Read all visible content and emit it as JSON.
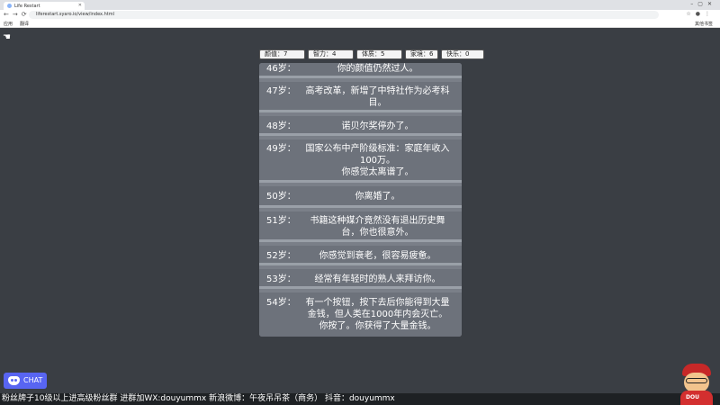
{
  "browser": {
    "tab_title": "Life Restart",
    "url": "liferestart.syaro.io/view/index.html",
    "bookmarks": {
      "apps": "应用",
      "folder": "翻译",
      "other": "其他书签"
    }
  },
  "stats": [
    {
      "label": "颜值：7"
    },
    {
      "label": "智力：4"
    },
    {
      "label": "体质：5"
    },
    {
      "label": "家境：6"
    },
    {
      "label": "快乐：0"
    }
  ],
  "events": [
    {
      "age": "46岁：",
      "lines": [
        "你的颜值仍然过人。"
      ]
    },
    {
      "age": "47岁：",
      "lines": [
        "高考改革，新增了中特社作为必考科",
        "目。"
      ]
    },
    {
      "age": "48岁：",
      "lines": [
        "诺贝尔奖停办了。"
      ]
    },
    {
      "age": "49岁：",
      "lines": [
        "国家公布中产阶级标准：家庭年收入",
        "100万。",
        "你感觉太离谱了。"
      ]
    },
    {
      "age": "50岁：",
      "lines": [
        "你离婚了。"
      ]
    },
    {
      "age": "51岁：",
      "lines": [
        "书籍这种媒介竟然没有退出历史舞",
        "台，你也很意外。"
      ]
    },
    {
      "age": "52岁：",
      "lines": [
        "你感觉到衰老，很容易疲惫。"
      ]
    },
    {
      "age": "53岁：",
      "lines": [
        "经常有年轻时的熟人来拜访你。"
      ]
    },
    {
      "age": "54岁：",
      "lines": [
        "有一个按钮，按下去后你能得到大量",
        "金钱，但人类在1000年内会灭亡。",
        "你按了。你获得了大量金钱。"
      ]
    }
  ],
  "overlay": {
    "chat_label": "CHAT",
    "ticker": "粉丝牌子10级以上进高级粉丝群  进群加WX:douyummx 新浪微博：午夜吊吊茶（商务）    抖音：douyummx",
    "mascot_text": "DOU"
  }
}
